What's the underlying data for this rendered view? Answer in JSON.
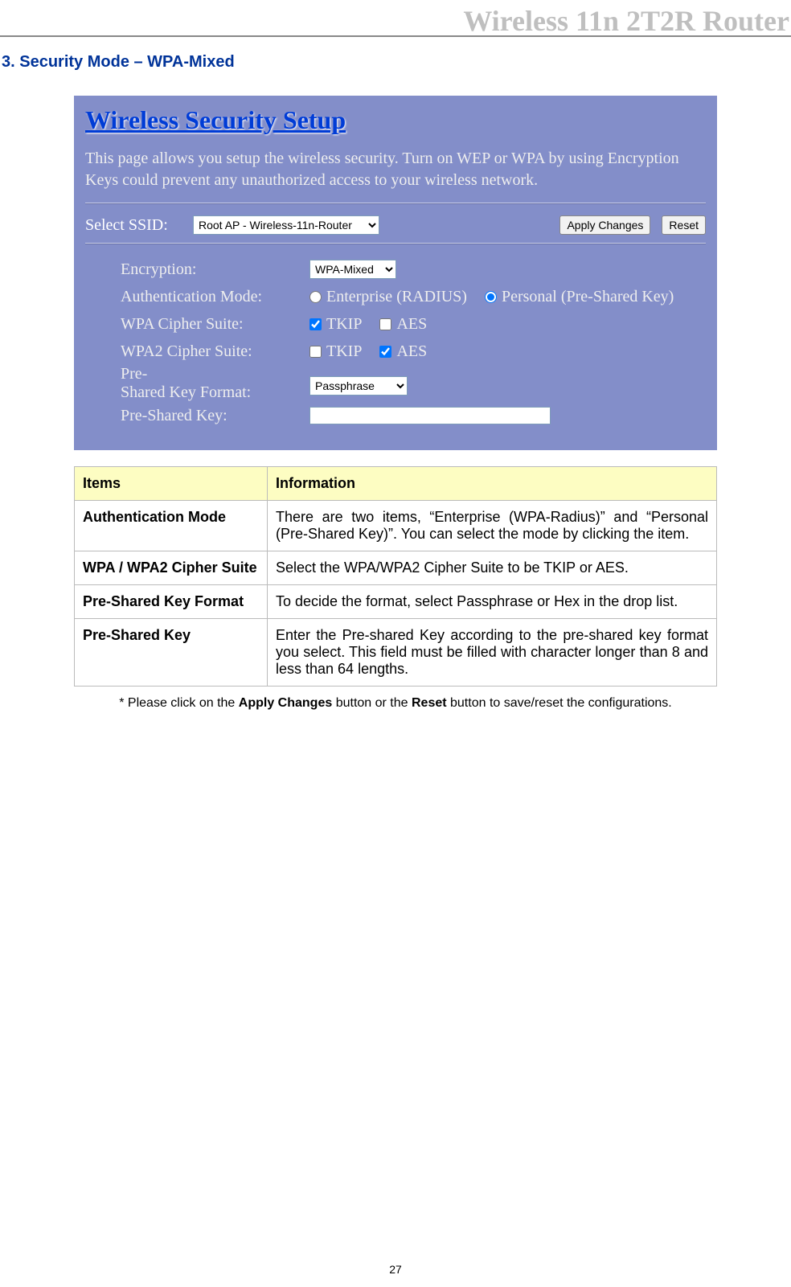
{
  "header": {
    "title": "Wireless 11n 2T2R Router"
  },
  "section": {
    "title": "3. Security Mode – WPA-Mixed"
  },
  "panel": {
    "title": "Wireless Security Setup",
    "description": "This page allows you setup the wireless security. Turn on WEP or WPA by using Encryption Keys could prevent any unauthorized access to your wireless network.",
    "ssid": {
      "label": "Select SSID:",
      "value": "Root AP - Wireless-11n-Router",
      "apply_label": "Apply Changes",
      "reset_label": "Reset"
    },
    "encryption": {
      "label": "Encryption:",
      "value": "WPA-Mixed"
    },
    "auth_mode": {
      "label": "Authentication Mode:",
      "options": [
        {
          "label": "Enterprise (RADIUS)",
          "selected": false
        },
        {
          "label": "Personal (Pre-Shared Key)",
          "selected": true
        }
      ]
    },
    "wpa_cipher": {
      "label": "WPA Cipher Suite:",
      "options": [
        {
          "label": "TKIP",
          "checked": true
        },
        {
          "label": "AES",
          "checked": false
        }
      ]
    },
    "wpa2_cipher": {
      "label": "WPA2 Cipher Suite:",
      "options": [
        {
          "label": "TKIP",
          "checked": false
        },
        {
          "label": "AES",
          "checked": true
        }
      ]
    },
    "psk_format": {
      "label_line1": "Pre-",
      "label_line2": "Shared Key Format:",
      "value": "Passphrase"
    },
    "psk": {
      "label": "Pre-Shared Key:",
      "value": ""
    }
  },
  "table": {
    "headers": {
      "items": "Items",
      "info": "Information"
    },
    "rows": [
      {
        "item": "Authentication Mode",
        "info": "There are two items, “Enterprise (WPA-Radius)” and “Personal (Pre-Shared Key)”. You can select the mode by clicking the item."
      },
      {
        "item": "WPA / WPA2 Cipher Suite",
        "info": "Select the WPA/WPA2 Cipher Suite to be TKIP or AES."
      },
      {
        "item": "Pre-Shared Key Format",
        "info": "To decide the format, select Passphrase or Hex in the drop list."
      },
      {
        "item": "Pre-Shared Key",
        "info": "Enter the Pre-shared Key according to the pre-shared key format you select. This field must be filled with character longer than 8 and less than 64 lengths."
      }
    ]
  },
  "footnote": {
    "prefix": "* Please click on the ",
    "bold1": "Apply Changes",
    "mid": " button or the ",
    "bold2": "Reset",
    "suffix": " button to save/reset the configurations."
  },
  "page_number": "27"
}
